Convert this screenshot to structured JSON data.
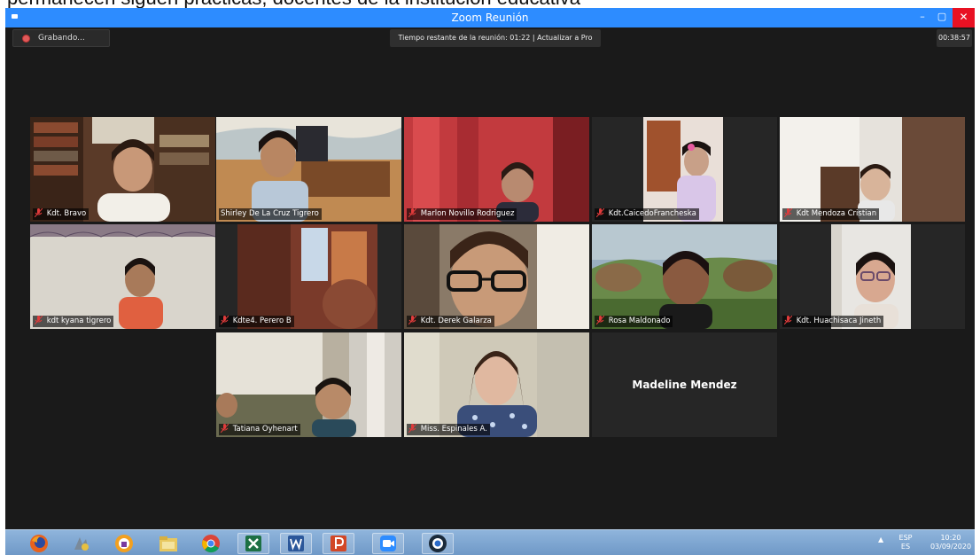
{
  "caption": "permanecen siguen prácticas, docentes de la institución educativa",
  "window": {
    "title": "Zoom Reunión",
    "minimize": "–",
    "maximize": "▢",
    "close": "✕"
  },
  "top_bar": {
    "recording": "Grabando...",
    "time_banner": "Tiempo restante de la reunión: 01:22 | Actualizar a Pro",
    "timer": "00:38:57"
  },
  "participants": [
    {
      "name": "Kdt. Bravo",
      "muted": true
    },
    {
      "name": "Shirley De La Cruz Tigrero",
      "muted": false,
      "active_speaker": true
    },
    {
      "name": "Marlon Novillo Rodriguez",
      "muted": true
    },
    {
      "name": "Kdt.CaicedoFrancheska",
      "muted": true
    },
    {
      "name": "Kdt Mendoza Cristian",
      "muted": true
    },
    {
      "name": "kdt kyana tigrero",
      "muted": true
    },
    {
      "name": "Kdte4. Perero B",
      "muted": true
    },
    {
      "name": "Kdt. Derek Galarza",
      "muted": true
    },
    {
      "name": "Rosa Maldonado",
      "muted": true
    },
    {
      "name": "Kdt. Huachisaca Jineth",
      "muted": true
    },
    {
      "name": "Tatiana Oyhenart",
      "muted": true
    },
    {
      "name": "Miss. Espinales A.",
      "muted": true
    },
    {
      "name": "Madeline Mendez",
      "video_off": true
    }
  ],
  "taskbar": {
    "apps": [
      "firefox-icon",
      "media-icon",
      "vpn-icon",
      "file-explorer-icon",
      "chrome-icon",
      "excel-icon",
      "word-icon",
      "powerpoint-icon",
      "zoom-icon",
      "webcam-icon"
    ],
    "lang_top": "ESP",
    "lang_bottom": "ES",
    "time": "10:20",
    "date": "03/09/2020"
  },
  "colors": {
    "zoom_blue": "#2d8cff",
    "active_speaker": "#c8e35a",
    "muted_red": "#e03b3b",
    "close_red": "#e81123"
  }
}
